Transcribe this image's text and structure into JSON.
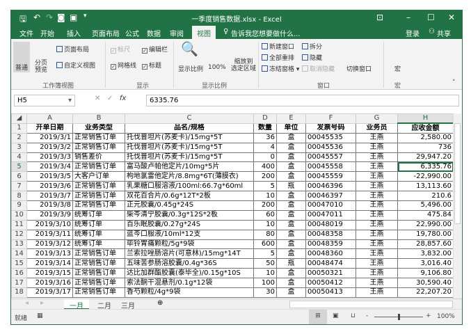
{
  "title": "一季度销售数据.xlsx - Excel",
  "tabs": [
    "文件",
    "开始",
    "插入",
    "页面布局",
    "公式",
    "数据",
    "审阅",
    "视图"
  ],
  "tell_me": "告诉我您想要做什么...",
  "login": "登录",
  "share": "共享",
  "ribbon": {
    "normal": "普通",
    "page_break": "分页\n预览",
    "page_layout": "页面布局",
    "custom_views": "自定义视图",
    "group_workbook_views": "工作簿视图",
    "ruler": "标尺",
    "formula_bar": "编辑栏",
    "gridlines": "网格线",
    "headings": "标题",
    "group_show": "显示",
    "zoom": "显示比例",
    "zoom100": "100%",
    "zoom_sel1": "缩放到",
    "zoom_sel2": "选定区域",
    "group_zoom": "显示比例",
    "new_window": "新建窗口",
    "arrange_all": "全部重排",
    "freeze": "冻结窗格",
    "split": "拆分",
    "hide": "隐藏",
    "unhide": "取消隐藏",
    "switch": "切换窗口",
    "group_window": "窗口",
    "macros": "宏",
    "group_macros": "宏"
  },
  "formula": {
    "namebox": "H5",
    "value": "6335.76"
  },
  "columns": [
    "A",
    "B",
    "C",
    "D",
    "E",
    "F",
    "G",
    "H"
  ],
  "headers": [
    "开单日期",
    "业务类型",
    "品名/规格",
    "数量",
    "单位",
    "发票号码",
    "业务员",
    "应收金额"
  ],
  "rows": [
    [
      "2019/3/1",
      "正常销售订单",
      "托伐普坦片(苏麦卡)/15mg*5T",
      "36",
      "盒",
      "00045535",
      "王燕",
      "2,580.00"
    ],
    [
      "2019/3/2",
      "正常销售订单",
      "托伐普坦片(苏麦卡)/15mg*5T",
      "4",
      "盒",
      "00045536",
      "王燕",
      "736"
    ],
    [
      "2019/3/3",
      "销售差价",
      "托伐普坦片(苏麦卡)/15mg*5T",
      "0",
      "盒",
      "00045557",
      "王燕",
      "29,947.20"
    ],
    [
      "2019/3/4",
      "正常销售订单",
      "富马酸卢帕他定片/10mg*5片",
      "400",
      "盒",
      "00045558",
      "王燕",
      "6,335.76"
    ],
    [
      "2019/3/5",
      "大客户订单",
      "枸地氯雷他定片/8.8mg*6T(薄膜衣)",
      "200",
      "盒",
      "00045559",
      "王燕",
      "-22,990.00"
    ],
    [
      "2019/3/6",
      "正常销售订单",
      "乳果糖口服溶液/100ml:66.7g*60ml",
      "5",
      "瓶",
      "00046396",
      "王燕",
      "13,113.60"
    ],
    [
      "2019/3/7",
      "正常销售订单",
      "双花百合片/0.6g*12T*2板",
      "10",
      "盒",
      "00046397",
      "王燕",
      "210.6"
    ],
    [
      "2019/3/8",
      "正常销售订单",
      "正元胶囊/0.45g*24S",
      "200",
      "盒",
      "00047010",
      "王燕",
      "5,496.00"
    ],
    [
      "2019/3/9",
      "统筹订单",
      "柴芩清宁胶囊/0.3g*12S*2板",
      "60",
      "盒",
      "00047011",
      "王燕",
      "475.84"
    ],
    [
      "2019/3/10",
      "统筹订单",
      "百乐眠胶囊/0.27g*24S",
      "10",
      "盒",
      "00048019",
      "王燕",
      "22,990.00"
    ],
    [
      "2019/3/11",
      "统筹订单",
      "蓝芩口服液/10ml*12支",
      "80",
      "盒",
      "00048358",
      "王燕",
      "19,780.00"
    ],
    [
      "2019/3/12",
      "统筹订单",
      "荜铃胃痛颗粒/5g*9袋",
      "600",
      "盒",
      "00048359",
      "王燕",
      "28,857.60"
    ],
    [
      "2019/3/13",
      "正常销售订单",
      "兰索拉唑肠溶片(可意林)/15mg*14T",
      "5",
      "盒",
      "00048360",
      "王燕",
      "3,832.00"
    ],
    [
      "2019/3/14",
      "正常销售订单",
      "五味苦参肠溶胶囊/0.4g*36S",
      "50",
      "瓶",
      "00048474",
      "王燕",
      "3,016.40"
    ],
    [
      "2019/3/15",
      "正常销售订单",
      "达比加群酯胶囊(泰毕全)/0.15g*10S",
      "10",
      "盒",
      "00050321",
      "王燕",
      "9,106.80"
    ],
    [
      "2019/3/16",
      "正常销售订单",
      "索法酮干混悬剂/0.1g*12袋",
      "100",
      "盒",
      "00050412",
      "王燕",
      "30,590.40"
    ],
    [
      "2019/3/17",
      "正常销售订单",
      "香芍颗粒/4g*9袋",
      "30",
      "盒",
      "00050413",
      "王燕",
      "22,207.20"
    ]
  ],
  "sheets": [
    "一月",
    "二月",
    "三月"
  ],
  "status": {
    "ready": "就绪",
    "zoom": "100%",
    "zoom_fraction": 0.5
  },
  "accent": "#217346"
}
